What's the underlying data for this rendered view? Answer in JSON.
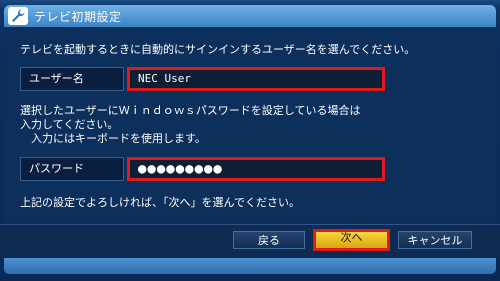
{
  "window": {
    "title": "テレビ初期設定",
    "icon": "wrench-icon"
  },
  "instruction": "テレビを起動するときに自動的にサインインするユーザー名を選んでください。",
  "user_field": {
    "label": "ユーザー名",
    "value": "NEC User"
  },
  "password_description": {
    "line1": "選択したユーザーにＷｉｎｄｏｗｓパスワードを設定している場合は",
    "line2": "入力してください。",
    "line3": "　入力にはキーボードを使用します。"
  },
  "password_field": {
    "label": "パスワード",
    "value": "●●●●●●●●●"
  },
  "confirm_text": "上記の設定でよろしければ、「次へ」を選んでください。",
  "buttons": {
    "back": "戻る",
    "next": "次へ",
    "cancel": "キャンセル"
  },
  "colors": {
    "highlight": "#e01b1b",
    "accent": "#3d84c6",
    "background": "#0c2f5c"
  }
}
